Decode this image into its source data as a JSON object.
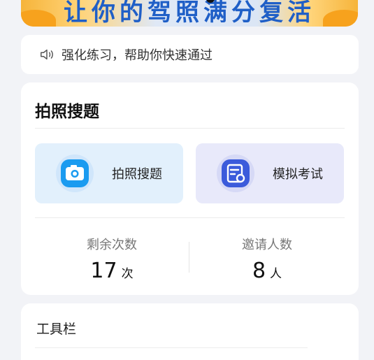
{
  "banner": {
    "text": "让你的驾照满分复活"
  },
  "notice": {
    "text": "强化练习，帮助你快速通过",
    "icon": "speaker-icon"
  },
  "main_card": {
    "title": "拍照搜题",
    "tiles": [
      {
        "label": "拍照搜题",
        "icon": "camera-icon",
        "color": "#1a9bf0"
      },
      {
        "label": "模拟考试",
        "icon": "exam-icon",
        "color": "#3b5bdb"
      }
    ],
    "stats": [
      {
        "label": "剩余次数",
        "value": "17",
        "unit": "次"
      },
      {
        "label": "邀请人数",
        "value": "8",
        "unit": "人"
      }
    ]
  },
  "toolbar": {
    "title": "工具栏"
  },
  "colors": {
    "page_bg": "#f2f3f7",
    "card_bg": "#ffffff",
    "photo_tile_bg": "#e2f0fc",
    "exam_tile_bg": "#e8e9fa",
    "brand_blue": "#1f5fc7",
    "banner_orange": "#f6b43a"
  }
}
